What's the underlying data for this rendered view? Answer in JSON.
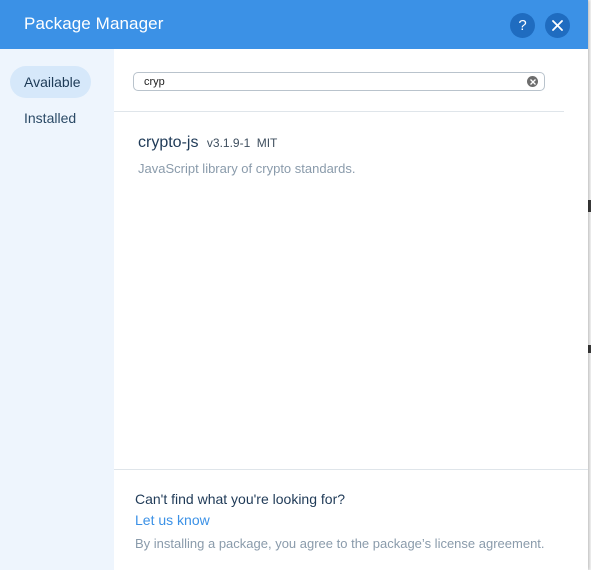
{
  "header": {
    "title": "Package Manager",
    "help_icon": "question-mark-icon",
    "close_icon": "close-icon",
    "help_label": "?"
  },
  "sidebar": {
    "items": [
      {
        "label": "Available",
        "active": true
      },
      {
        "label": "Installed",
        "active": false
      }
    ]
  },
  "search": {
    "value": "cryp",
    "placeholder": "",
    "clear_icon": "clear-x-icon"
  },
  "results": [
    {
      "name": "crypto-js",
      "version": "v3.1.9-1",
      "license": "MIT",
      "description": "JavaScript library of crypto standards."
    }
  ],
  "footer": {
    "question": "Can't find what you're looking for?",
    "link_label": "Let us know",
    "note": "By installing a package, you agree to the package’s license agreement."
  },
  "colors": {
    "header_bg": "#3b91e6",
    "header_button_bg": "#1f6cc0",
    "sidebar_bg": "#eef5fd",
    "sidebar_active_bg": "#d6e8fa",
    "link": "#3b91e6",
    "muted_text": "#8a9bab"
  }
}
